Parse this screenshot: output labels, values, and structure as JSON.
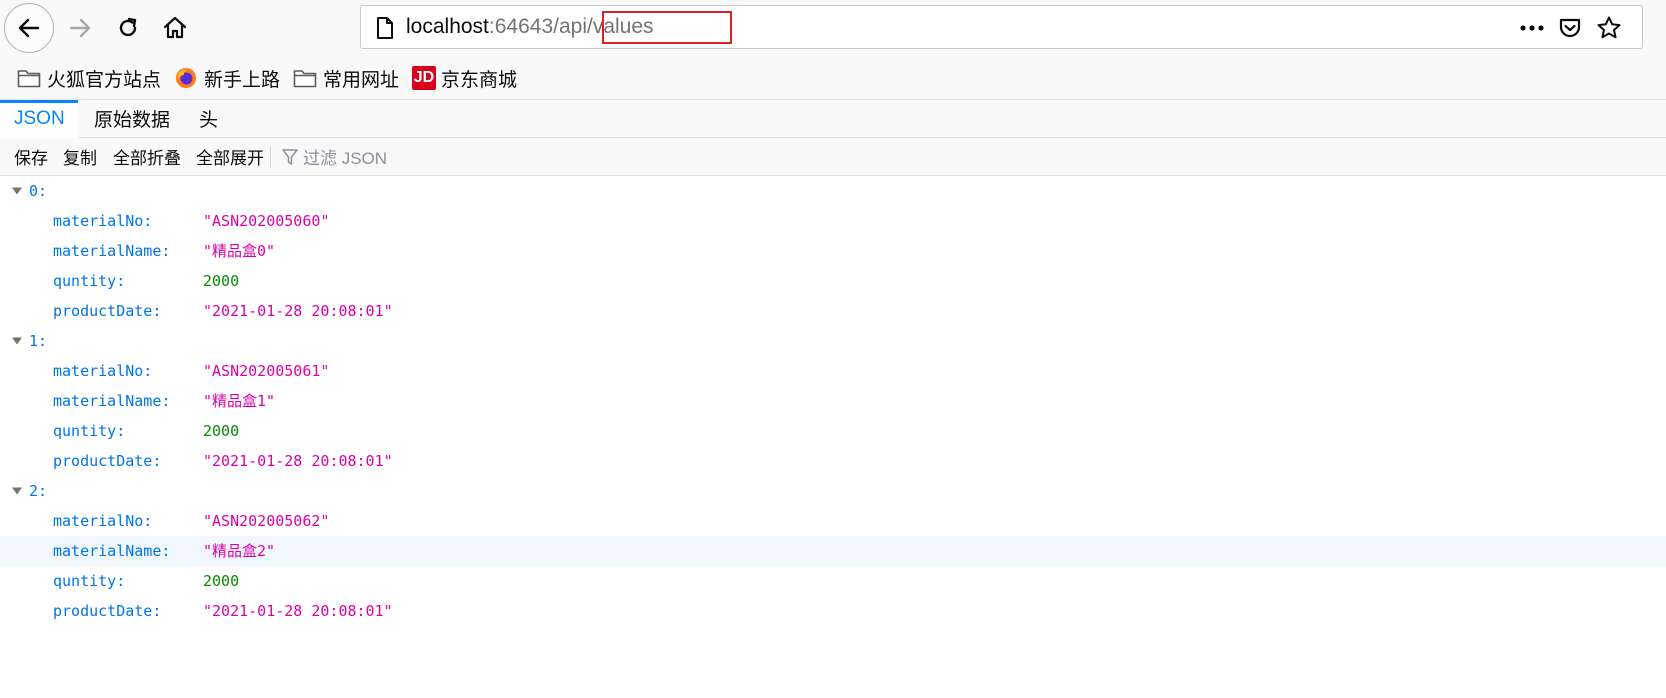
{
  "browser": {
    "url_host": "localhost",
    "url_port": ":64643",
    "url_path": "/api/values",
    "icons": {
      "back": "back-arrow-icon",
      "forward": "forward-arrow-icon",
      "reload": "reload-icon",
      "home": "home-icon",
      "page": "page-icon",
      "more": "more-dots-icon",
      "pocket": "pocket-icon",
      "bookmark": "star-icon"
    }
  },
  "bookmarks": [
    {
      "label": "火狐官方站点",
      "icon": "folder-icon"
    },
    {
      "label": "新手上路",
      "icon": "firefox-logo-icon"
    },
    {
      "label": "常用网址",
      "icon": "folder-icon"
    },
    {
      "label": "京东商城",
      "icon": "jd-logo-icon",
      "icon_text": "JD"
    }
  ],
  "tabs": [
    {
      "label": "JSON",
      "active": true
    },
    {
      "label": "原始数据",
      "active": false
    },
    {
      "label": "头",
      "active": false
    }
  ],
  "toolbar": {
    "save": "保存",
    "copy": "复制",
    "collapse_all": "全部折叠",
    "expand_all": "全部展开",
    "filter_placeholder": "过滤 JSON"
  },
  "json": [
    {
      "index": "0:",
      "fields": [
        {
          "key": "materialNo:",
          "value": "\"ASN202005060\"",
          "type": "string"
        },
        {
          "key": "materialName:",
          "value": "\"精品盒0\"",
          "type": "string"
        },
        {
          "key": "quntity:",
          "value": "2000",
          "type": "number"
        },
        {
          "key": "productDate:",
          "value": "\"2021-01-28 20:08:01\"",
          "type": "string"
        }
      ]
    },
    {
      "index": "1:",
      "fields": [
        {
          "key": "materialNo:",
          "value": "\"ASN202005061\"",
          "type": "string"
        },
        {
          "key": "materialName:",
          "value": "\"精品盒1\"",
          "type": "string"
        },
        {
          "key": "quntity:",
          "value": "2000",
          "type": "number"
        },
        {
          "key": "productDate:",
          "value": "\"2021-01-28 20:08:01\"",
          "type": "string"
        }
      ]
    },
    {
      "index": "2:",
      "fields": [
        {
          "key": "materialNo:",
          "value": "\"ASN202005062\"",
          "type": "string"
        },
        {
          "key": "materialName:",
          "value": "\"精品盒2\"",
          "type": "string"
        },
        {
          "key": "quntity:",
          "value": "2000",
          "type": "number"
        },
        {
          "key": "productDate:",
          "value": "\"2021-01-28 20:08:01\"",
          "type": "string"
        }
      ]
    }
  ],
  "colors": {
    "accent": "#0a84ff",
    "key": "#0074e8",
    "string": "#dd00a9",
    "number": "#058b00",
    "highlight_border": "#e02020"
  }
}
